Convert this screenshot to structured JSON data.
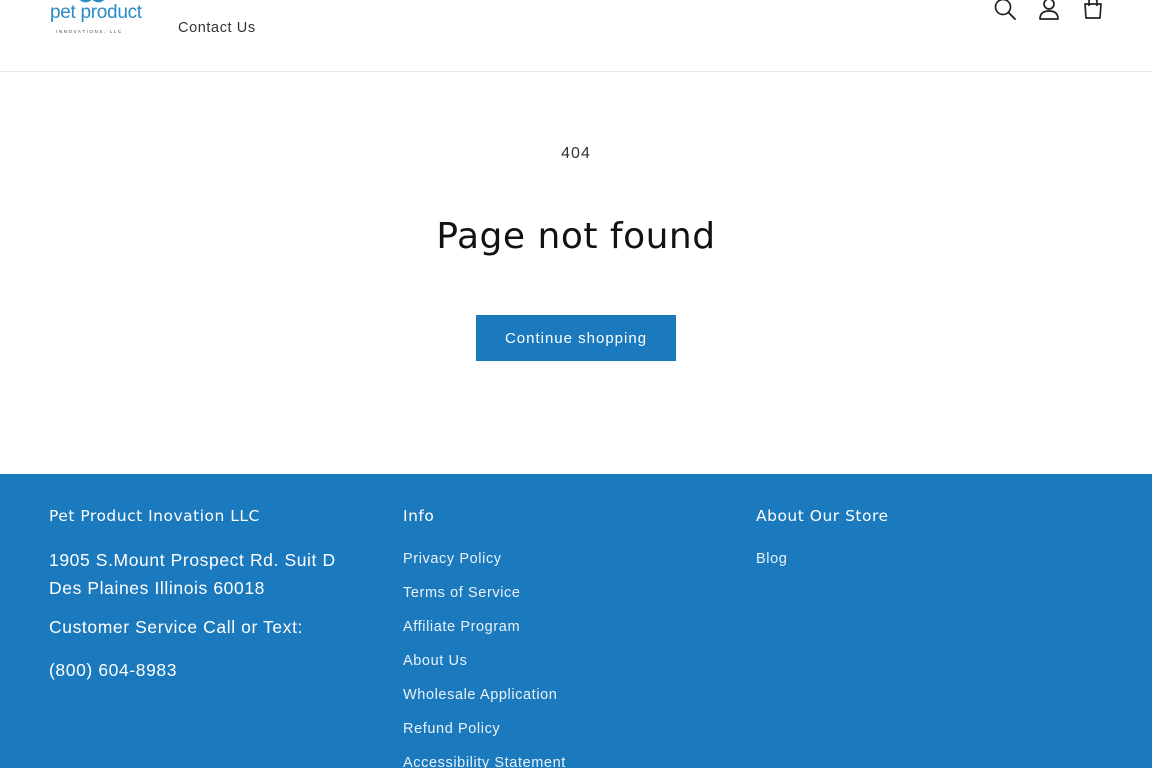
{
  "header": {
    "logo_text": "pet product",
    "logo_subtext": "INNOVATIONS, LLC",
    "nav": [
      {
        "label": "Contact Us"
      }
    ],
    "icons": [
      "search-icon",
      "account-icon",
      "cart-icon"
    ]
  },
  "main": {
    "code": "404",
    "title": "Page not found",
    "button_label": "Continue shopping"
  },
  "footer": {
    "company": {
      "heading": "Pet Product Inovation LLC",
      "address": "1905 S.Mount Prospect Rd. Suit D Des Plaines Illinois 60018",
      "service_label": "Customer Service Call or Text:",
      "phone": "(800) 604-8983"
    },
    "info": {
      "heading": "Info",
      "links": [
        "Privacy Policy",
        "Terms of Service",
        "Affiliate Program",
        "About Us",
        "Wholesale Application",
        "Refund Policy",
        "Accessibility Statement"
      ]
    },
    "about": {
      "heading": "About Our Store",
      "links": [
        "Blog"
      ]
    }
  },
  "colors": {
    "accent": "#1b79bd",
    "logo_blue": "#2a8ac6",
    "logo_green": "#7dbb42",
    "text": "#121212"
  }
}
